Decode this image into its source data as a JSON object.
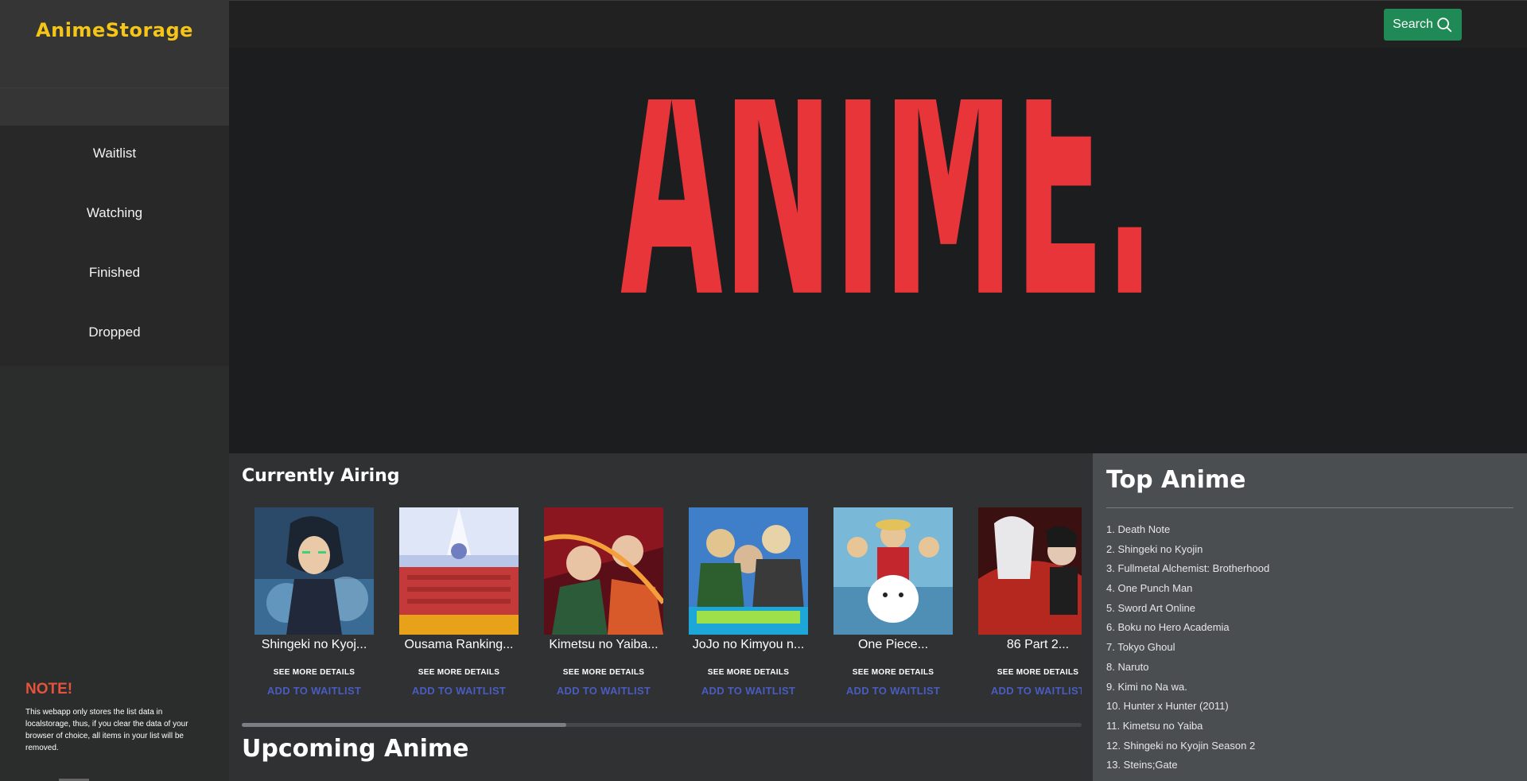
{
  "app": {
    "logo": "AnimeStorage"
  },
  "sidebar": {
    "items": [
      {
        "label": "Waitlist"
      },
      {
        "label": "Watching"
      },
      {
        "label": "Finished"
      },
      {
        "label": "Dropped"
      }
    ],
    "note": {
      "title": "NOTE!",
      "text": "This webapp only stores the list data in localstorage, thus, if you clear the data of your browser of choice, all items in your list will be removed."
    }
  },
  "header": {
    "search_label": "Search",
    "search_icon": "search-icon"
  },
  "hero": {
    "text": "ANIME."
  },
  "airing": {
    "title": "Currently Airing",
    "cards": [
      {
        "name": "Shingeki no Kyoj...",
        "more": "SEE MORE DETAILS",
        "add": "ADD TO WAITLIST"
      },
      {
        "name": "Ousama Ranking...",
        "more": "SEE MORE DETAILS",
        "add": "ADD TO WAITLIST"
      },
      {
        "name": "Kimetsu no Yaiba...",
        "more": "SEE MORE DETAILS",
        "add": "ADD TO WAITLIST"
      },
      {
        "name": "JoJo no Kimyou n...",
        "more": "SEE MORE DETAILS",
        "add": "ADD TO WAITLIST"
      },
      {
        "name": "One Piece...",
        "more": "SEE MORE DETAILS",
        "add": "ADD TO WAITLIST"
      },
      {
        "name": "86 Part 2...",
        "more": "SEE MORE DETAILS",
        "add": "ADD TO WAITLIST"
      }
    ]
  },
  "upcoming": {
    "title": "Upcoming Anime"
  },
  "top": {
    "title": "Top Anime",
    "items": [
      "1. Death Note",
      "2. Shingeki no Kyojin",
      "3. Fullmetal Alchemist: Brotherhood",
      "4. One Punch Man",
      "5. Sword Art Online",
      "6. Boku no Hero Academia",
      "7. Tokyo Ghoul",
      "8. Naruto",
      "9. Kimi no Na wa.",
      "10. Hunter x Hunter (2011)",
      "11. Kimetsu no Yaiba",
      "12. Shingeki no Kyojin Season 2",
      "13. Steins;Gate"
    ]
  },
  "colors": {
    "brand": "#f5c518",
    "hero_red": "#e8353a",
    "search_button": "#1f8a55",
    "note_title": "#e5533d",
    "waitlist_link": "#4a5cc0"
  }
}
